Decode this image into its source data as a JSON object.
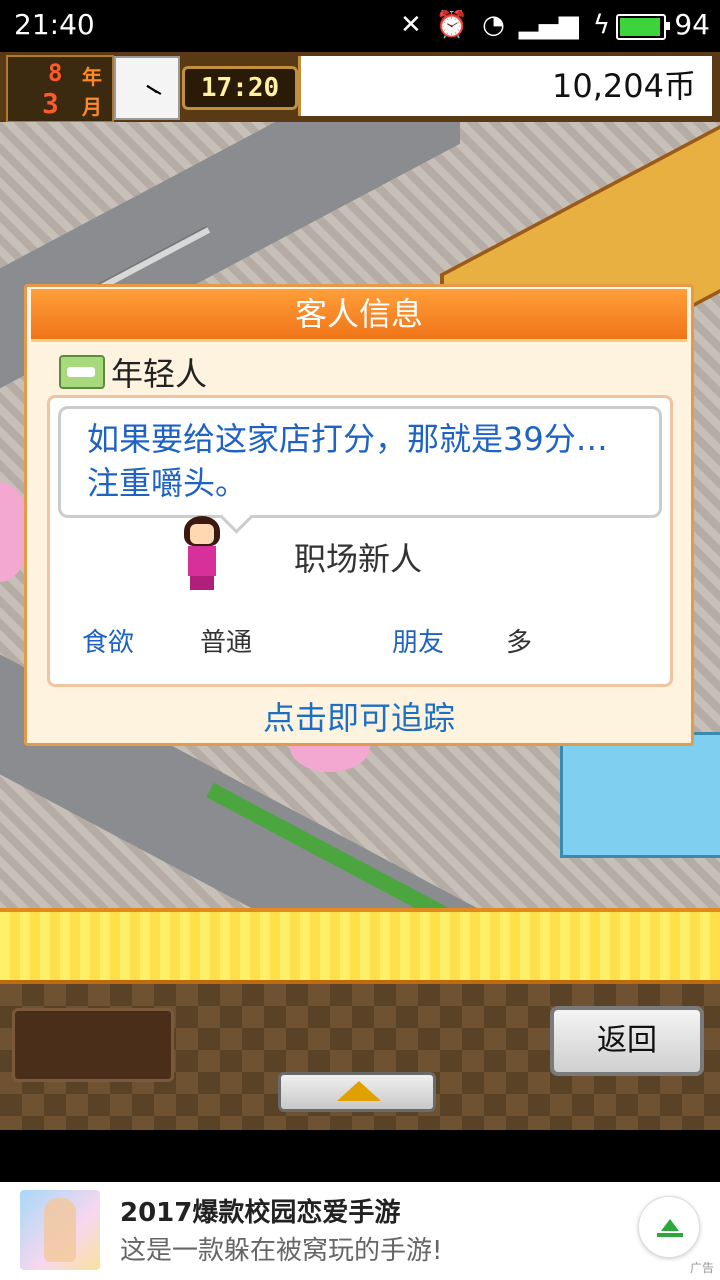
{
  "status_bar": {
    "time": "21:40",
    "icons": [
      "mute-icon",
      "alarm-icon",
      "wifi-icon",
      "signal-4g-icon",
      "charging-icon"
    ],
    "battery_percent": "94",
    "battery_level": 0.94
  },
  "game_header": {
    "year": "8",
    "year_unit": "年",
    "month": "3",
    "month_unit": "月",
    "time": "17:20",
    "coins": "10,204币"
  },
  "dialog": {
    "title": "客人信息",
    "customer_type": "年轻人",
    "quote_line1": "如果要给这家店打分，那就是39分…",
    "quote_line2": "注重嚼头。",
    "occupation": "职场新人",
    "stats": [
      {
        "label": "食欲",
        "value": "普通"
      },
      {
        "label": "朋友",
        "value": "多"
      }
    ],
    "track_label": "点击即可追踪"
  },
  "controls": {
    "back_label": "返回"
  },
  "ad": {
    "title": "2017爆款校园恋爱手游",
    "subtitle": "这是一款躲在被窝玩的手游!",
    "tag": "广告"
  },
  "colors": {
    "dialog_title_bg": "#f07418",
    "link_blue": "#1d62c4",
    "ticker_yellow": "#ffe04a"
  }
}
